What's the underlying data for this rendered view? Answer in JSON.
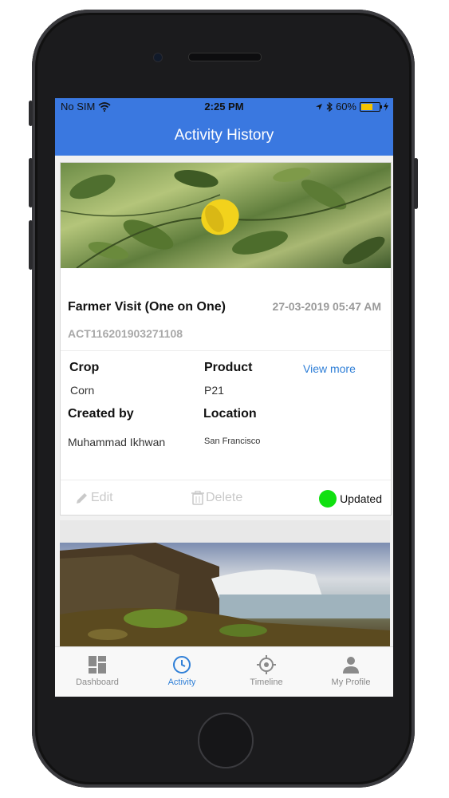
{
  "status": {
    "carrier": "No SIM",
    "time": "2:25 PM",
    "battery": "60%"
  },
  "appbar": {
    "title": "Activity History"
  },
  "card": {
    "title": "Farmer Visit (One on One)",
    "date": "27-03-2019 05:47 AM",
    "activity_id": "ACT116201903271108",
    "crop_label": "Crop",
    "crop_value": "Corn",
    "product_label": "Product",
    "product_value": "P21",
    "view_more": "View more",
    "created_label": "Created by",
    "created_value": "Muhammad Ikhwan",
    "location_label": "Location",
    "location_value": "San Francisco",
    "edit_label": "Edit",
    "delete_label": "Delete",
    "status_label": "Updated",
    "status_color": "#10e010"
  },
  "tabs": [
    {
      "label": "Dashboard",
      "icon": "dashboard-icon"
    },
    {
      "label": "Activity",
      "icon": "clock-icon"
    },
    {
      "label": "Timeline",
      "icon": "target-icon"
    },
    {
      "label": "My Profile",
      "icon": "person-icon"
    }
  ],
  "colors": {
    "accent": "#3a78e0",
    "link": "#2f7fd7"
  }
}
